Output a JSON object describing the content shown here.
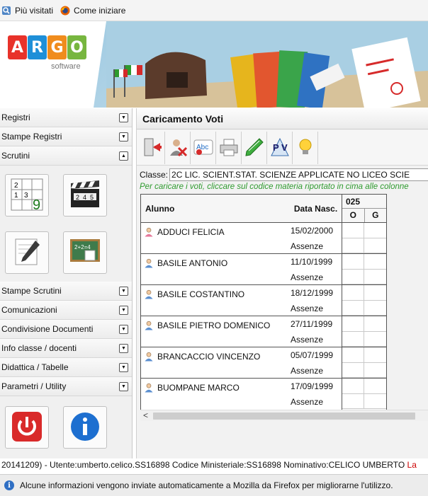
{
  "bookmarks": [
    {
      "label": "Più visitati",
      "icon": "bookmark-star-icon"
    },
    {
      "label": "Come iniziare",
      "icon": "firefox-icon"
    }
  ],
  "logo": {
    "letters": [
      "A",
      "R",
      "G",
      "O"
    ],
    "letter_colors": [
      "#e8322a",
      "#1e8fd8",
      "#f08c1d",
      "#77b63f"
    ],
    "subtitle": "software"
  },
  "sidebar": {
    "sections_top": [
      {
        "label": "Registri",
        "state": "collapsed"
      },
      {
        "label": "Stampe Registri",
        "state": "collapsed"
      },
      {
        "label": "Scrutini",
        "state": "expanded"
      }
    ],
    "scrutini_tiles": [
      {
        "icon": "grades-grid-icon",
        "grid_digits": [
          "2",
          "3",
          "1",
          "9"
        ]
      },
      {
        "icon": "clapperboard-icon",
        "digits": [
          "2",
          "4",
          "5"
        ]
      },
      {
        "icon": "pencil-document-icon"
      },
      {
        "icon": "chalkboard-icon",
        "board_text": "2+2=4"
      }
    ],
    "sections_bottom": [
      {
        "label": "Stampe Scrutini"
      },
      {
        "label": "Comunicazioni"
      },
      {
        "label": "Condivisione Documenti"
      },
      {
        "label": "Info classe / docenti"
      },
      {
        "label": "Didattica / Tabelle"
      },
      {
        "label": "Parametri / Utility"
      }
    ],
    "bottom_tiles": [
      {
        "icon": "power-icon"
      },
      {
        "icon": "info-icon"
      }
    ]
  },
  "main": {
    "title": "Caricamento Voti",
    "toolbar": [
      {
        "icon": "exit-icon"
      },
      {
        "icon": "absent-student-icon"
      },
      {
        "icon": "spellcheck-icon"
      },
      {
        "icon": "printer-icon"
      },
      {
        "icon": "green-pen-icon"
      },
      {
        "icon": "pdf-v-icon",
        "text": "P V"
      },
      {
        "icon": "lightbulb-icon"
      }
    ],
    "classe_label": "Classe:",
    "classe_value": "2C LIC. SCIENT.STAT. SCIENZE APPLICATE NO LICEO SCIE",
    "hint": "Per caricare i voti, cliccare sul codice materia riportato in cima alle colonne",
    "grid": {
      "col_student": "Alunno",
      "col_birth": "Data Nasc.",
      "subject_code": "025",
      "col_o": "O",
      "col_g": "G",
      "absence_label": "Assenze",
      "students": [
        {
          "name": "ADDUCI FELICIA",
          "birth": "15/02/2000",
          "gender": "F"
        },
        {
          "name": "BASILE ANTONIO",
          "birth": "11/10/1999",
          "gender": "M"
        },
        {
          "name": "BASILE COSTANTINO",
          "birth": "18/12/1999",
          "gender": "M"
        },
        {
          "name": "BASILE PIETRO DOMENICO",
          "birth": "27/11/1999",
          "gender": "M"
        },
        {
          "name": "BRANCACCIO VINCENZO",
          "birth": "05/07/1999",
          "gender": "M"
        },
        {
          "name": "BUOMPANE MARCO",
          "birth": "17/09/1999",
          "gender": "M"
        }
      ]
    }
  },
  "status_bar": {
    "text": "20141209) - Utente:umberto.celico.SS16898 Codice Ministeriale:SS16898 Nominativo:CELICO UMBERTO",
    "trailing_red": "La"
  },
  "notification": {
    "text": "Alcune informazioni vengono inviate automaticamente a Mozilla da Firefox per migliorarne l'utilizzo."
  }
}
